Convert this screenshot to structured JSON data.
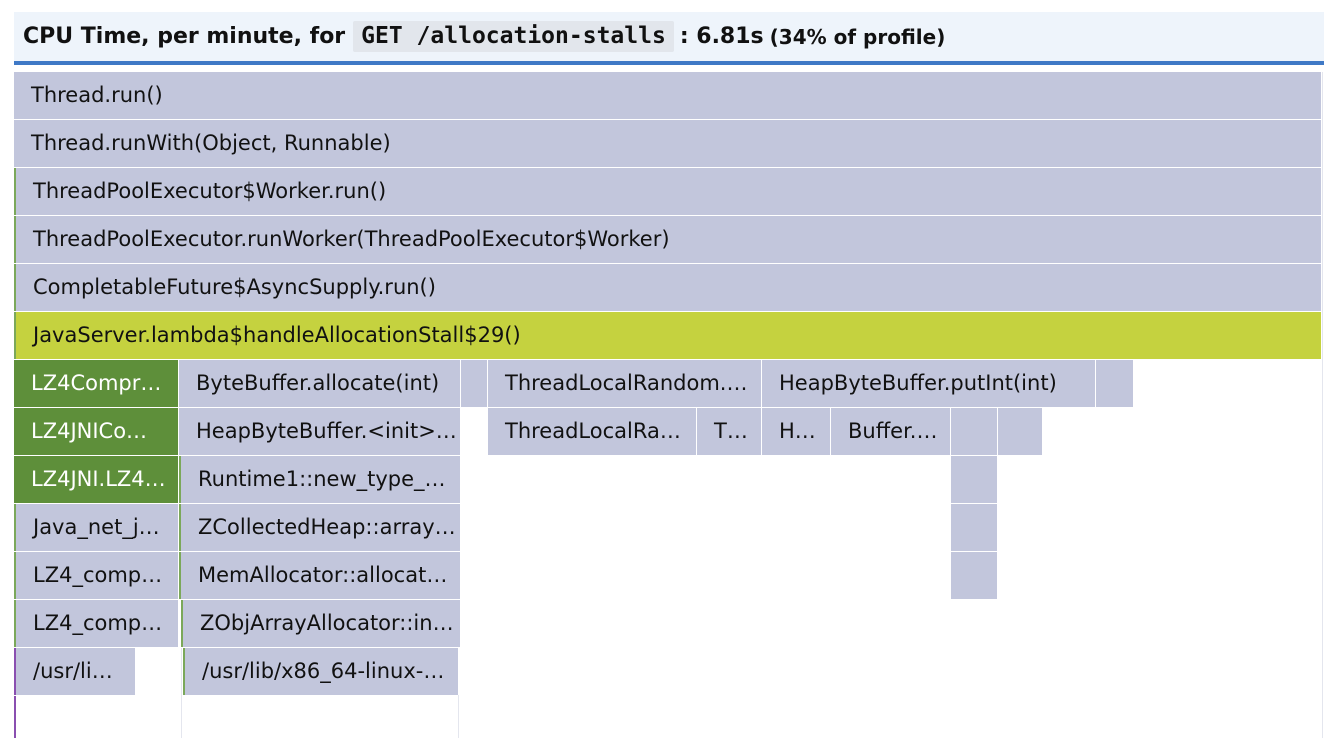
{
  "header": {
    "prefix": "CPU Time, per minute, for",
    "endpoint": "GET /allocation-stalls",
    "value": ": 6.81s",
    "percent": "(34% of profile)"
  },
  "colors": {
    "header_bg": "#eef4fb",
    "header_border": "#3f79c6",
    "frame": "#c2c6dc",
    "highlight": "#c5d23f",
    "native_lz4": "#5e8f3a",
    "purple_marker": "#8a4fb0"
  },
  "frames": {
    "r0": "Thread.run()",
    "r1": "Thread.runWith(Object, Runnable)",
    "r2": "ThreadPoolExecutor$Worker.run()",
    "r3": "ThreadPoolExecutor.runWorker(ThreadPoolExecutor$Worker)",
    "r4": "CompletableFuture$AsyncSupply.run()",
    "r5": "JavaServer.lambda$handleAllocationStall$29()",
    "r6_lz4": "LZ4Compr…",
    "r6_bb": "ByteBuffer.allocate(int)",
    "r6_tlr": "ThreadLocalRandom.…",
    "r6_hbb": "HeapByteBuffer.putInt(int)",
    "r7_lz4": "LZ4JNICo…",
    "r7_hbb": "HeapByteBuffer.<init>…",
    "r7_tlr": "ThreadLocalRa…",
    "r7_t": "T…",
    "r7_h": "H…",
    "r7_buf": "Buffer.…",
    "r8_lz4": "LZ4JNI.LZ4…",
    "r8_rt": "Runtime1::new_type_…",
    "r9_java": "Java_net_j…",
    "r9_zch": "ZCollectedHeap::array…",
    "r10_lz4": "LZ4_comp…",
    "r10_mem": "MemAllocator::allocat…",
    "r11_lz4": "LZ4_comp…",
    "r11_zobj": "ZObjArrayAllocator::in…",
    "r12_usr": "/usr/li…",
    "r12_lib": "/usr/lib/x86_64-linux-…"
  }
}
